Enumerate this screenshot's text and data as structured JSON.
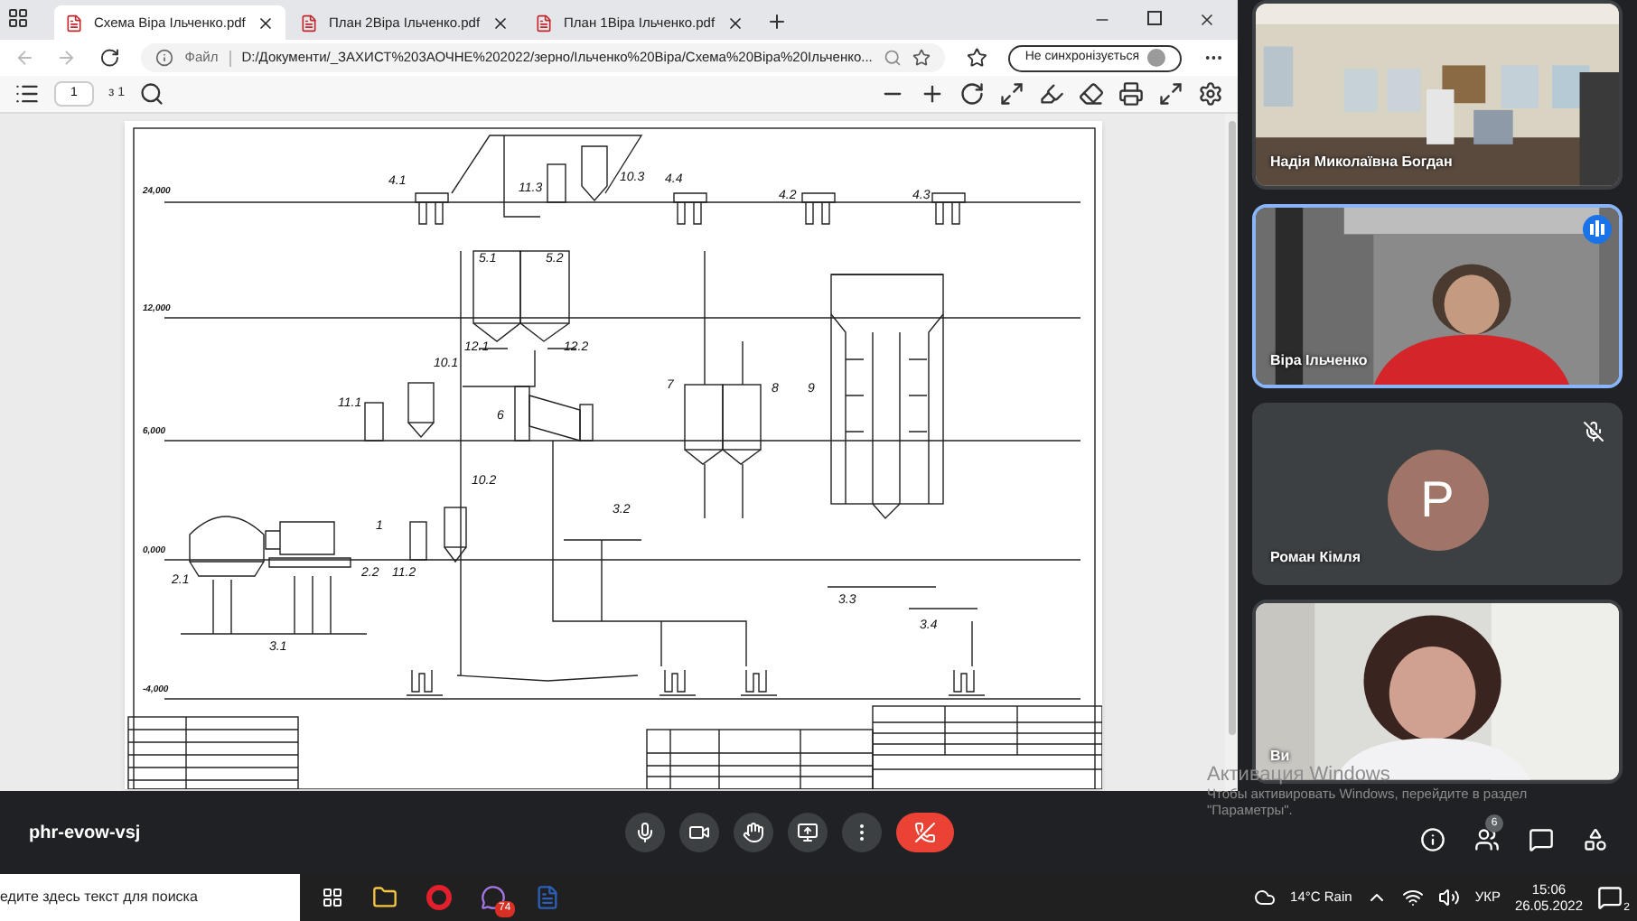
{
  "browser": {
    "tabs": [
      {
        "title": "Схема Віра Ільченко.pdf",
        "selected": true
      },
      {
        "title": "План 2Віра Ільченко.pdf",
        "selected": false
      },
      {
        "title": "План 1Віра Ільченко.pdf",
        "selected": false
      }
    ],
    "address": {
      "label": "Файл",
      "url": "D:/Документи/_ЗАХИСТ%203АОЧНЕ%202022/зерно/Ільченко%20Віра/Схема%20Віра%20Ільченко..."
    },
    "profile_button": "Не синхронізується",
    "pdf_toolbar": {
      "page": "1",
      "page_count": "з 1"
    },
    "drawing": {
      "labels": [
        "24,000",
        "12,000",
        "6,000",
        "0,000",
        "-4,000",
        "4.1",
        "11.3",
        "10.3",
        "4.4",
        "4.2",
        "4.3",
        "5.1",
        "5.2",
        "12.1",
        "12.2",
        "10.1",
        "11.1",
        "6",
        "7",
        "8",
        "9",
        "10.2",
        "11.2",
        "2.1",
        "2.2",
        "1",
        "3.1",
        "3.2",
        "3.3",
        "3.4"
      ]
    }
  },
  "participants": [
    {
      "name": "Надія Миколаївна Богдан",
      "kind": "video",
      "speaking": false,
      "muted": false
    },
    {
      "name": "Віра Ільченко",
      "kind": "video",
      "speaking": true,
      "muted": false
    },
    {
      "name": "Роман Кімля",
      "kind": "avatar",
      "initial": "Р",
      "speaking": false,
      "muted": true
    },
    {
      "name": "Ви",
      "kind": "video",
      "speaking": false,
      "muted": false
    }
  ],
  "activation": {
    "title": "Активация Windows",
    "text": "Чтобы активировать Windows, перейдите в раздел \"Параметры\"."
  },
  "meeting": {
    "code": "phr-evow-vsj",
    "people_count": "6"
  },
  "taskbar": {
    "search": "едите здесь текст для поиска",
    "viber_badge": "74",
    "weather": "14°C Rain",
    "language": "УКР",
    "time": "15:06",
    "date": "26.05.2022",
    "notifications": "2"
  }
}
